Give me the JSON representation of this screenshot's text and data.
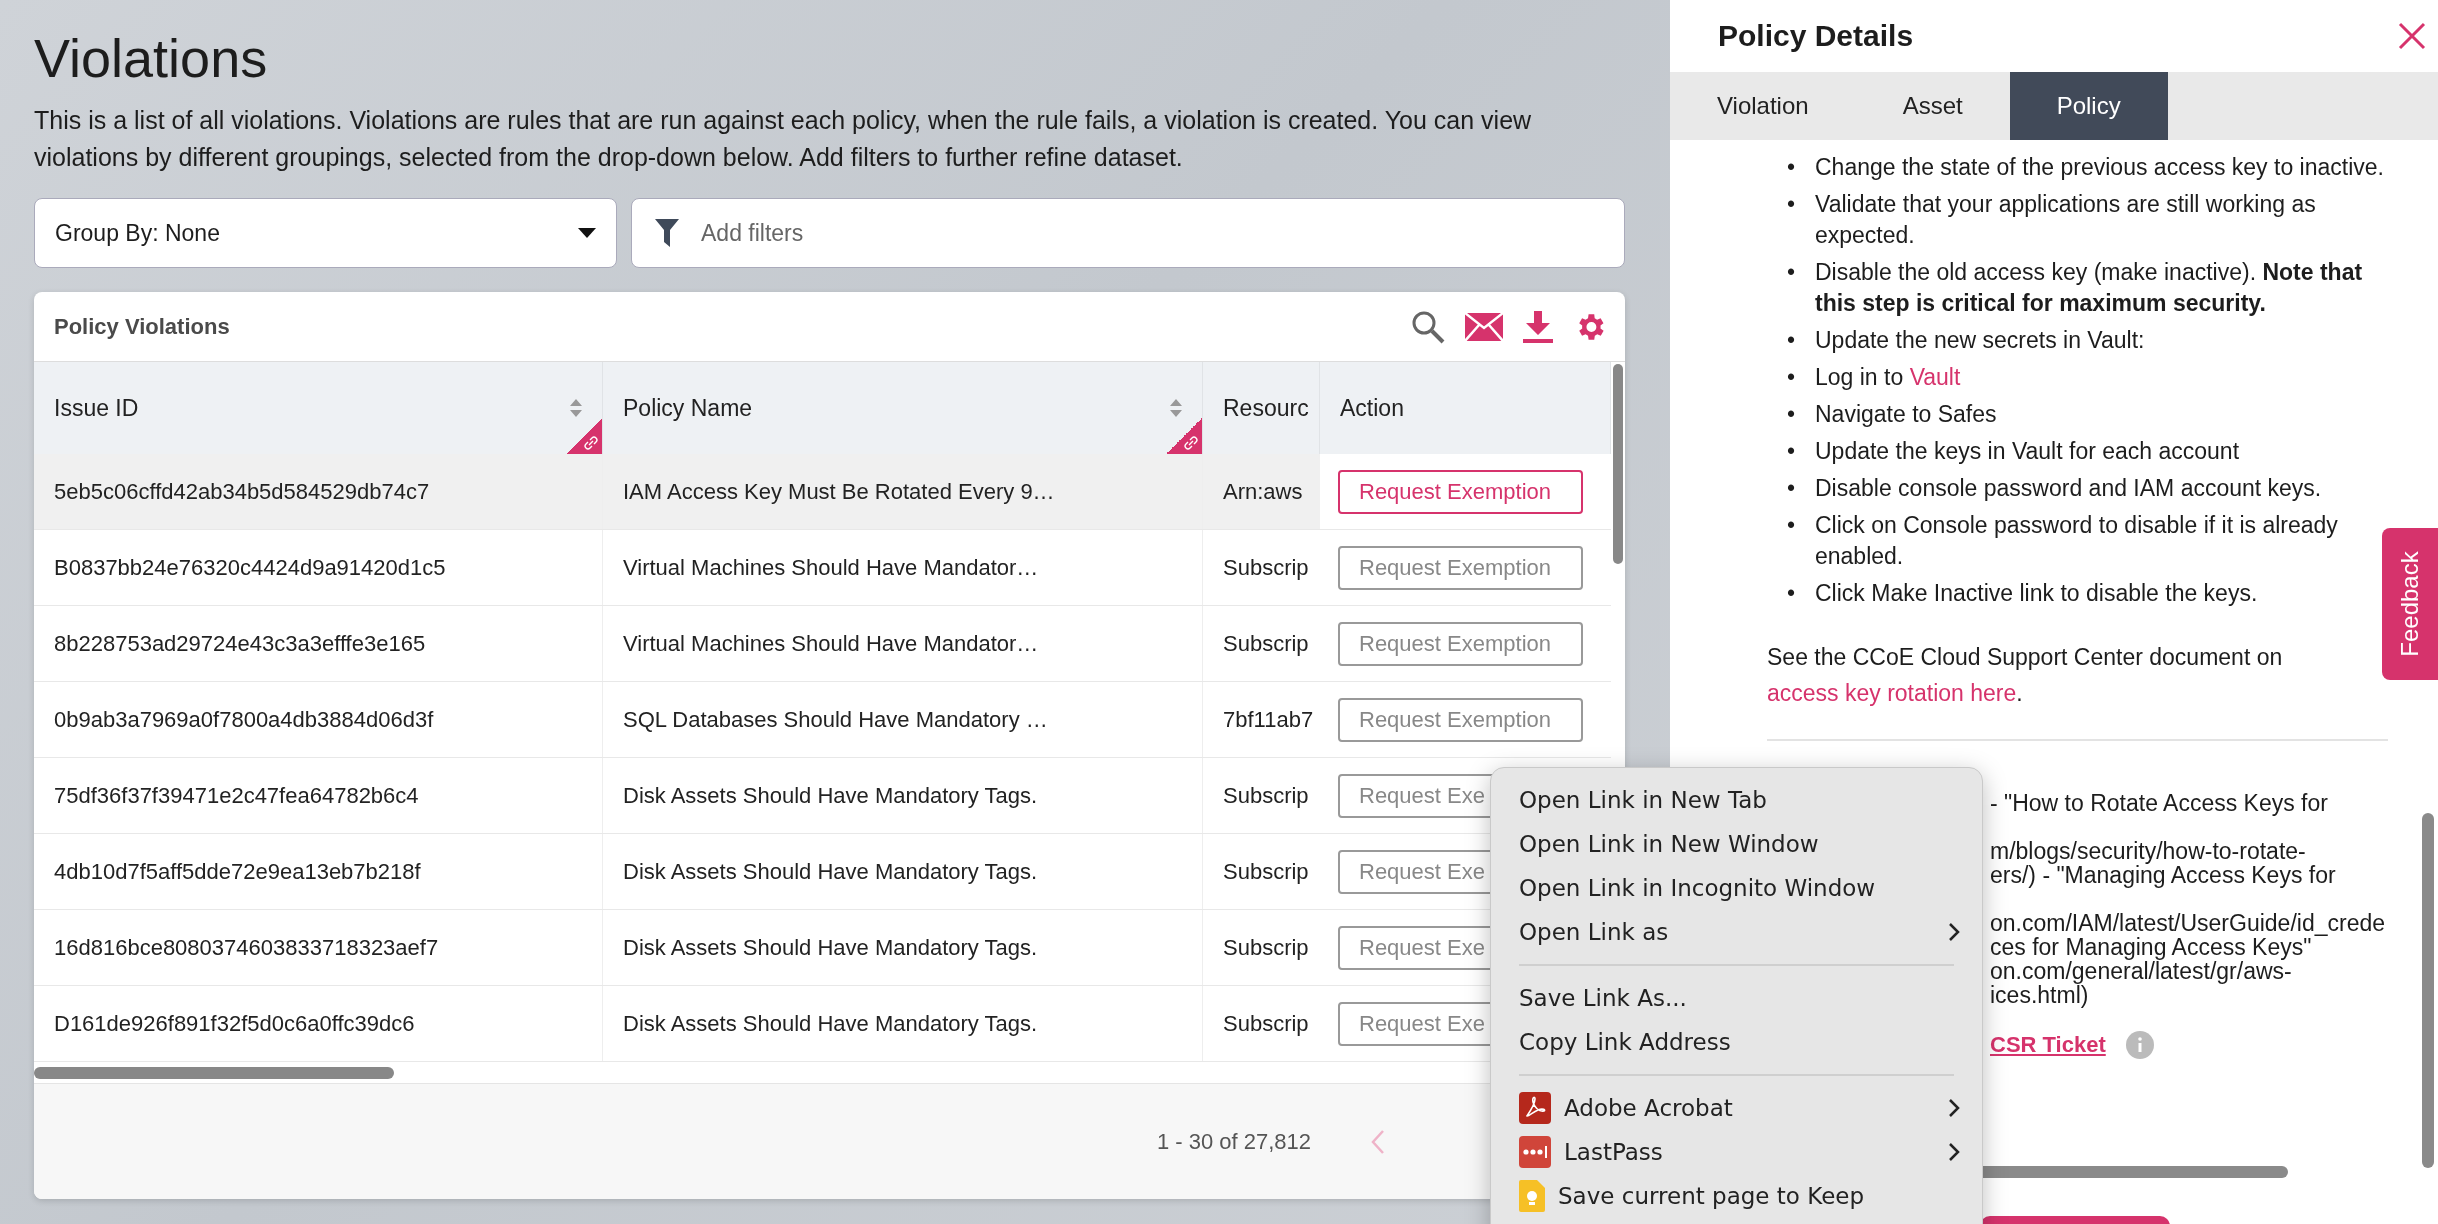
{
  "page": {
    "title": "Violations",
    "description": "This is a list of all violations. Violations are rules that are run against each policy, when the rule fails, a violation is created. You can view violations by different groupings, selected from the drop-down below. Add filters to further refine dataset."
  },
  "group_by": {
    "value": "Group By: None"
  },
  "filter": {
    "placeholder": "Add filters"
  },
  "table": {
    "title": "Policy Violations",
    "columns": [
      {
        "label": "Issue ID",
        "sortable": true
      },
      {
        "label": "Policy Name",
        "sortable": true
      },
      {
        "label": "Resourc",
        "sortable": false
      },
      {
        "label": "Action",
        "sortable": false
      }
    ],
    "rows": [
      {
        "issue_id": "5eb5c06cffd42ab34b5d584529db74c7",
        "policy_name": "IAM Access Key Must Be Rotated Every 9…",
        "resource": "Arn:aws",
        "action": "Request Exemption",
        "selected": true
      },
      {
        "issue_id": "B0837bb24e76320c4424d9a91420d1c5",
        "policy_name": "Virtual Machines Should Have Mandator…",
        "resource": "Subscrip",
        "action": "Request Exemption",
        "selected": false
      },
      {
        "issue_id": "8b228753ad29724e43c3a3efffe3e165",
        "policy_name": "Virtual Machines Should Have Mandator…",
        "resource": "Subscrip",
        "action": "Request Exemption",
        "selected": false
      },
      {
        "issue_id": "0b9ab3a7969a0f7800a4db3884d06d3f",
        "policy_name": "SQL Databases Should Have Mandatory …",
        "resource": "7bf11ab7",
        "action": "Request Exemption",
        "selected": false
      },
      {
        "issue_id": "75df36f37f39471e2c47fea64782b6c4",
        "policy_name": "Disk Assets Should Have Mandatory Tags.",
        "resource": "Subscrip",
        "action": "Request Exe",
        "selected": false
      },
      {
        "issue_id": "4db10d7f5aff5dde72e9ea13eb7b218f",
        "policy_name": "Disk Assets Should Have Mandatory Tags.",
        "resource": "Subscrip",
        "action": "Request Exe",
        "selected": false
      },
      {
        "issue_id": "16d816bce8080374603833718323aef7",
        "policy_name": "Disk Assets Should Have Mandatory Tags.",
        "resource": "Subscrip",
        "action": "Request Exe",
        "selected": false
      },
      {
        "issue_id": "D161de926f891f32f5d0c6a0ffc39dc6",
        "policy_name": "Disk Assets Should Have Mandatory Tags.",
        "resource": "Subscrip",
        "action": "Request Exe",
        "selected": false
      }
    ],
    "pagination": "1 - 30 of 27,812"
  },
  "details": {
    "title": "Policy Details",
    "tabs": [
      {
        "label": "Violation",
        "selected": false
      },
      {
        "label": "Asset",
        "selected": false
      },
      {
        "label": "Policy",
        "selected": true
      }
    ],
    "steps": [
      {
        "bullet": "•",
        "text": "Change the state of the previous access key to inactive."
      },
      {
        "bullet": "•",
        "text": "Validate that your applications are still working as expected."
      },
      {
        "bullet": "•",
        "text": "Disable the old access key (make inactive). **Note that this step is critical for maximum security.**"
      },
      {
        "bullet": "•",
        "text": "Update the new secrets in Vault:"
      },
      {
        "bullet": "•",
        "text": "Log in to ",
        "link": "Vault"
      },
      {
        "bullet": "•",
        "text": "Navigate to Safes"
      },
      {
        "bullet": "•",
        "text": "Update the keys in Vault for each account"
      },
      {
        "bullet": "•",
        "text": "Disable console password and IAM account keys."
      },
      {
        "bullet": "•",
        "text": "Click on Console password to disable if it is already enabled."
      },
      {
        "bullet": "•",
        "text": "Click Make Inactive link to disable the keys."
      }
    ],
    "see_also": "See the CCoE Cloud Support Center document on",
    "see_also_link": "access key rotation here",
    "see_also_end": ".",
    "references": [
      [
        "- \"How to Rotate Access Keys for"
      ],
      [
        "m/blogs/security/how-to-rotate-",
        "ers/) - \"Managing Access Keys for"
      ],
      [
        "on.com/IAM/latest/UserGuide/id_crede",
        "ces for Managing Access Keys\"",
        "on.com/general/latest/gr/aws-",
        "ices.html)"
      ]
    ],
    "csr_link": "CSR Ticket"
  },
  "context_menu": {
    "items": [
      {
        "kind": "item",
        "label": "Open Link in New Tab",
        "submenu": false
      },
      {
        "kind": "item",
        "label": "Open Link in New Window",
        "submenu": false
      },
      {
        "kind": "item",
        "label": "Open Link in Incognito Window",
        "submenu": false
      },
      {
        "kind": "item",
        "label": "Open Link as",
        "submenu": true
      },
      {
        "kind": "divider"
      },
      {
        "kind": "item",
        "label": "Save Link As...",
        "submenu": false
      },
      {
        "kind": "item",
        "label": "Copy Link Address",
        "submenu": false
      },
      {
        "kind": "divider"
      },
      {
        "kind": "extension",
        "label": "Adobe Acrobat",
        "submenu": true
      },
      {
        "kind": "extension",
        "label": "LastPass",
        "submenu": true
      },
      {
        "kind": "extension",
        "label": "Save current page to Keep",
        "submenu": false
      }
    ]
  },
  "feedback": "Feedback"
}
